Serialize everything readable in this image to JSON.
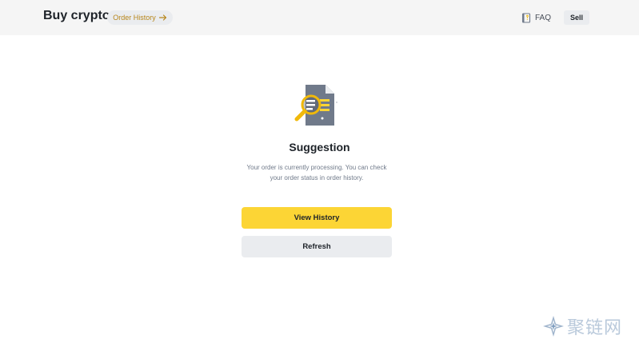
{
  "header": {
    "title": "Buy crypto",
    "order_history_label": "Order History",
    "faq_label": "FAQ",
    "sell_label": "Sell"
  },
  "main": {
    "heading": "Suggestion",
    "message": "Your order is currently processing. You can check your order status in order history.",
    "view_history_label": "View History",
    "refresh_label": "Refresh"
  },
  "watermark": {
    "text": "聚链网"
  },
  "colors": {
    "accent": "#fcd535",
    "link": "#b7861b",
    "header_bg": "#f5f5f5",
    "secondary_button": "#eaecef"
  },
  "icons": [
    "arrow-right-icon",
    "faq-book-icon",
    "document-search-icon",
    "watermark-logo-icon"
  ]
}
